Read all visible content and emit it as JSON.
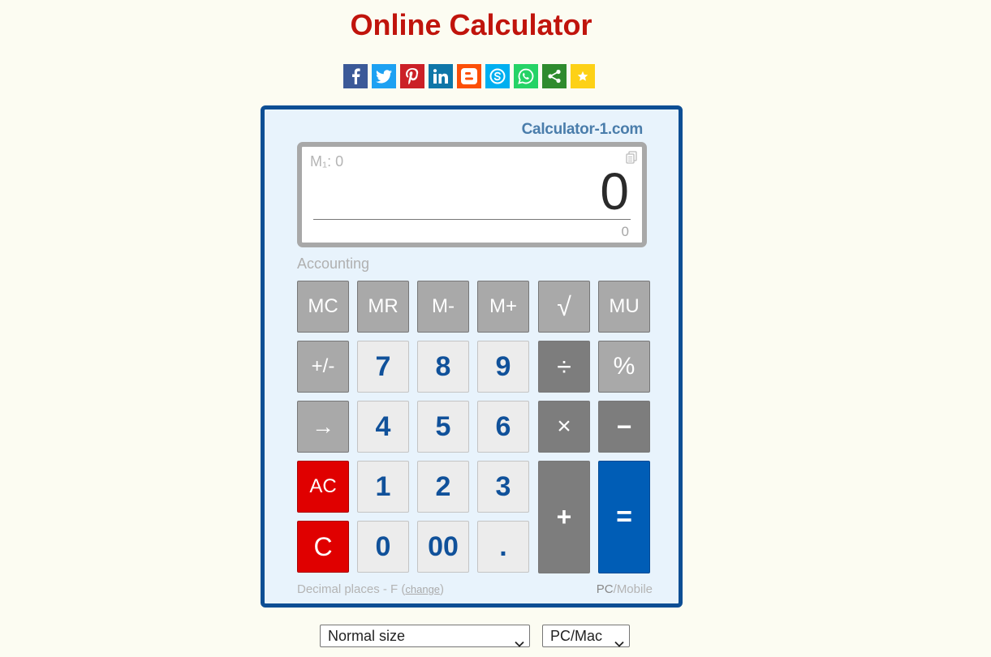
{
  "page": {
    "title": "Online Calculator"
  },
  "share": [
    {
      "icon": "facebook-icon",
      "color": "#3b5998",
      "glyph": "f"
    },
    {
      "icon": "twitter-icon",
      "color": "#1da1f2",
      "glyph": "t"
    },
    {
      "icon": "pinterest-icon",
      "color": "#cb2027",
      "glyph": "P"
    },
    {
      "icon": "linkedin-icon",
      "color": "#0e76a8",
      "glyph": "in"
    },
    {
      "icon": "blogger-icon",
      "color": "#fc4f08",
      "glyph": "B"
    },
    {
      "icon": "skype-icon",
      "color": "#00aff0",
      "glyph": "S"
    },
    {
      "icon": "whatsapp-icon",
      "color": "#25d366",
      "glyph": "W"
    },
    {
      "icon": "share-icon",
      "color": "#2e8b2e",
      "glyph": "<"
    },
    {
      "icon": "star-icon",
      "color": "#fdd116",
      "glyph": "★"
    }
  ],
  "calculator": {
    "brand": "Calculator-1.com",
    "memory": "M₁: 0",
    "display": "0",
    "subdisplay": "0",
    "mode": "Accounting",
    "keys": {
      "mc": "MC",
      "mr": "MR",
      "mminus": "M-",
      "mplus": "M+",
      "sqrt": "√",
      "mu": "MU",
      "sign": "+/-",
      "k7": "7",
      "k8": "8",
      "k9": "9",
      "div": "÷",
      "pct": "%",
      "back": "→",
      "k4": "4",
      "k5": "5",
      "k6": "6",
      "mul": "×",
      "minus": "−",
      "ac": "AC",
      "k1": "1",
      "k2": "2",
      "k3": "3",
      "plus": "+",
      "eq": "=",
      "c": "C",
      "k0": "0",
      "k00": "00",
      "dot": "."
    },
    "footer": {
      "decimal_text": "Decimal places - F",
      "paren_open": "(",
      "change_link": "change",
      "paren_close": ")",
      "pc": "PC",
      "slash": "/",
      "mobile": "Mobile"
    }
  },
  "colors": {
    "title": "#c0140c",
    "frame": "#0d4e94",
    "equals": "#005db6",
    "clear": "#e00000"
  },
  "selects": {
    "size": "Normal size",
    "platform": "PC/Mac"
  }
}
